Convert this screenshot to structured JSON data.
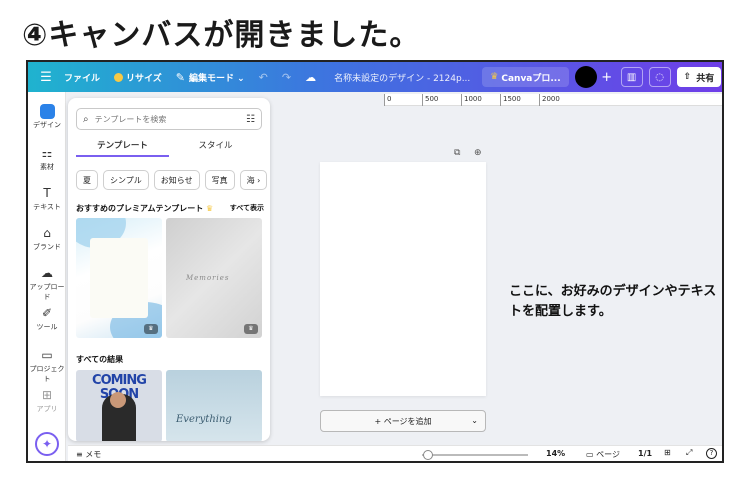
{
  "heading": "④キャンバスが開きました。",
  "topbar": {
    "file": "ファイル",
    "resize": "リサイズ",
    "edit_mode": "編集モード",
    "edit_chevron": "⌄",
    "doc_title": "名称未設定のデザイン - 2124p...",
    "canva_pro": "Canvaプロ...",
    "share": "共有"
  },
  "rail": {
    "design": "デザイン",
    "elements": "素材",
    "text": "テキスト",
    "brand": "ブランド",
    "upload": "アップロード",
    "tools": "ツール",
    "projects": "プロジェクト",
    "apps": "アプリ"
  },
  "panel": {
    "search_placeholder": "テンプレートを検索",
    "tabs": [
      "テンプレート",
      "スタイル"
    ],
    "chips": [
      "夏",
      "シンプル",
      "お知らせ",
      "写真",
      "海"
    ],
    "premium_title": "おすすめのプレミアムテンプレート",
    "see_all": "すべて表示",
    "all_results": "すべての結果",
    "thumb_memories": "Memories",
    "thumb_coming_soon": "COMING SOON",
    "thumb_everything": "Everything"
  },
  "ruler": [
    "0",
    "500",
    "1000",
    "1500",
    "2000"
  ],
  "canvas": {
    "add_page": "+ ページを追加"
  },
  "bottombar": {
    "memo": "メモ",
    "zoom": "14%",
    "zoom_value": 14,
    "pages_label": "ページ",
    "page_count": "1/1",
    "help": "?"
  },
  "caption": "ここに、お好みのデザインやテキストを配置します。",
  "colors": {
    "topbar_start": "#1fb3cf",
    "topbar_end": "#6f3ee8",
    "accent": "#7a5ff0",
    "active_rail": "#2b82e8"
  }
}
